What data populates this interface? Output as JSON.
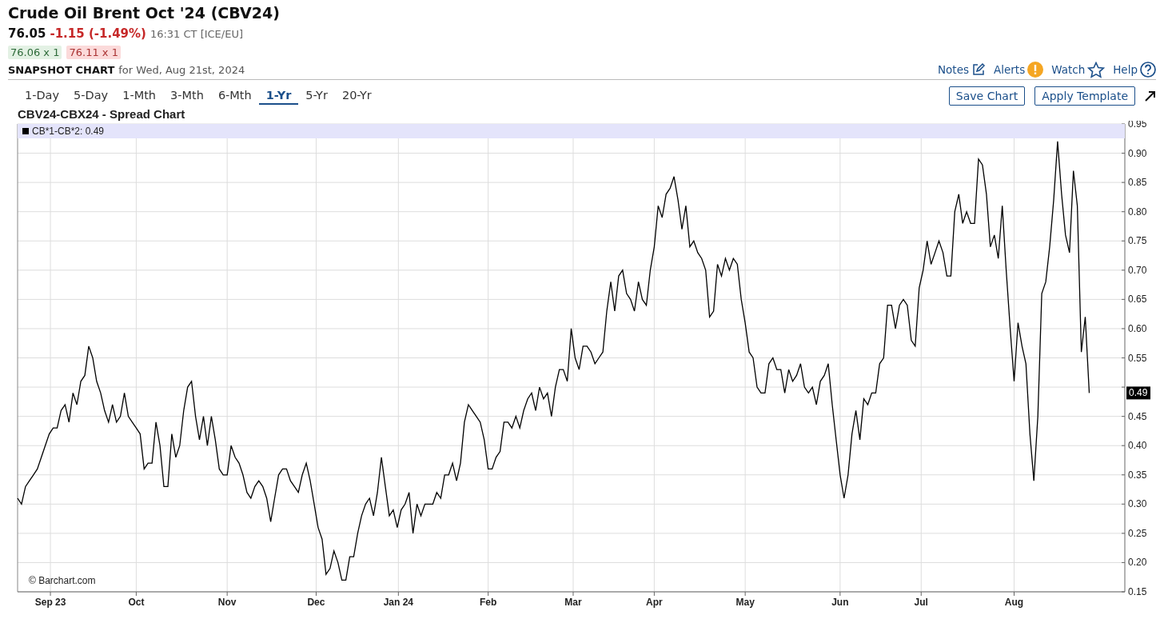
{
  "header": {
    "title": "Crude Oil Brent Oct '24 (CBV24)",
    "last": "76.05",
    "change": "-1.15 (-1.49%)",
    "time": "16:31 CT [ICE/EU]",
    "bid": "76.06 x 1",
    "ask": "76.11 x 1",
    "snapshot_label": "SNAPSHOT CHART",
    "snapshot_date": "for Wed, Aug 21st, 2024"
  },
  "links": [
    {
      "label": "Notes",
      "kind": "notes"
    },
    {
      "label": "Alerts",
      "kind": "alerts"
    },
    {
      "label": "Watch",
      "kind": "watch"
    },
    {
      "label": "Help",
      "kind": "help"
    }
  ],
  "ranges": [
    {
      "label": "1-Day",
      "selected": false
    },
    {
      "label": "5-Day",
      "selected": false
    },
    {
      "label": "1-Mth",
      "selected": false
    },
    {
      "label": "3-Mth",
      "selected": false
    },
    {
      "label": "6-Mth",
      "selected": false
    },
    {
      "label": "1-Yr",
      "selected": true
    },
    {
      "label": "5-Yr",
      "selected": false
    },
    {
      "label": "20-Yr",
      "selected": false
    }
  ],
  "buttons": [
    "Save Chart",
    "Apply Template"
  ],
  "chart": {
    "title": "CBV24-CBX24 - Spread Chart",
    "legend_suffix": ": 0.49",
    "last_label": "0.49",
    "credit": "© Barchart.com",
    "month_labels": [
      "Sep 23",
      "Oct",
      "Nov",
      "Dec",
      "Jan 24",
      "Feb",
      "Mar",
      "Apr",
      "May",
      "Jun",
      "Jul",
      "Aug"
    ],
    "chart_data": {
      "type": "line",
      "grid": true,
      "ylim": [
        0.15,
        0.95
      ],
      "yticks": [
        {
          "value": 0.15,
          "label": "0.15"
        },
        {
          "value": 0.2,
          "label": "0.20"
        },
        {
          "value": 0.25,
          "label": "0.25"
        },
        {
          "value": 0.3,
          "label": "0.30"
        },
        {
          "value": 0.35,
          "label": "0.35"
        },
        {
          "value": 0.4,
          "label": "0.40"
        },
        {
          "value": 0.45,
          "label": "0.45"
        },
        {
          "value": 0.55,
          "label": "0.55"
        },
        {
          "value": 0.6,
          "label": "0.60"
        },
        {
          "value": 0.65,
          "label": "0.65"
        },
        {
          "value": 0.7,
          "label": "0.70"
        },
        {
          "value": 0.75,
          "label": "0.75"
        },
        {
          "value": 0.8,
          "label": "0.80"
        },
        {
          "value": 0.85,
          "label": "0.85"
        },
        {
          "value": 0.9,
          "label": "0.90"
        },
        {
          "value": 0.95,
          "label": "0.95"
        }
      ],
      "series": [
        {
          "name": "CB*1-CB*2",
          "color": "#000000",
          "values": [
            0.31,
            0.3,
            0.33,
            0.34,
            0.35,
            0.36,
            0.38,
            0.4,
            0.42,
            0.43,
            0.43,
            0.46,
            0.47,
            0.44,
            0.49,
            0.47,
            0.51,
            0.52,
            0.57,
            0.55,
            0.51,
            0.49,
            0.46,
            0.44,
            0.47,
            0.44,
            0.45,
            0.49,
            0.45,
            0.44,
            0.43,
            0.42,
            0.36,
            0.37,
            0.37,
            0.44,
            0.4,
            0.33,
            0.33,
            0.42,
            0.38,
            0.4,
            0.46,
            0.5,
            0.51,
            0.45,
            0.41,
            0.45,
            0.4,
            0.45,
            0.41,
            0.36,
            0.35,
            0.35,
            0.4,
            0.38,
            0.37,
            0.35,
            0.32,
            0.31,
            0.33,
            0.34,
            0.33,
            0.31,
            0.27,
            0.31,
            0.35,
            0.36,
            0.36,
            0.34,
            0.33,
            0.32,
            0.35,
            0.37,
            0.34,
            0.3,
            0.26,
            0.24,
            0.18,
            0.19,
            0.22,
            0.2,
            0.17,
            0.17,
            0.21,
            0.21,
            0.25,
            0.28,
            0.3,
            0.31,
            0.28,
            0.32,
            0.38,
            0.33,
            0.28,
            0.29,
            0.26,
            0.29,
            0.3,
            0.32,
            0.25,
            0.3,
            0.28,
            0.3,
            0.3,
            0.3,
            0.32,
            0.31,
            0.35,
            0.35,
            0.37,
            0.34,
            0.37,
            0.44,
            0.47,
            0.46,
            0.45,
            0.44,
            0.41,
            0.36,
            0.36,
            0.38,
            0.39,
            0.44,
            0.44,
            0.43,
            0.45,
            0.43,
            0.46,
            0.48,
            0.49,
            0.46,
            0.5,
            0.48,
            0.49,
            0.45,
            0.5,
            0.53,
            0.53,
            0.51,
            0.6,
            0.55,
            0.53,
            0.57,
            0.57,
            0.56,
            0.54,
            0.55,
            0.56,
            0.63,
            0.68,
            0.63,
            0.69,
            0.7,
            0.66,
            0.65,
            0.63,
            0.68,
            0.65,
            0.64,
            0.7,
            0.74,
            0.81,
            0.79,
            0.83,
            0.84,
            0.86,
            0.82,
            0.77,
            0.81,
            0.74,
            0.75,
            0.73,
            0.72,
            0.7,
            0.62,
            0.63,
            0.71,
            0.69,
            0.72,
            0.7,
            0.72,
            0.71,
            0.65,
            0.61,
            0.56,
            0.55,
            0.5,
            0.49,
            0.49,
            0.54,
            0.55,
            0.53,
            0.53,
            0.49,
            0.53,
            0.51,
            0.52,
            0.54,
            0.5,
            0.49,
            0.5,
            0.47,
            0.51,
            0.52,
            0.54,
            0.47,
            0.41,
            0.35,
            0.31,
            0.35,
            0.42,
            0.46,
            0.41,
            0.48,
            0.47,
            0.49,
            0.49,
            0.54,
            0.55,
            0.64,
            0.64,
            0.6,
            0.64,
            0.65,
            0.64,
            0.58,
            0.57,
            0.67,
            0.7,
            0.75,
            0.71,
            0.73,
            0.75,
            0.73,
            0.69,
            0.69,
            0.8,
            0.83,
            0.78,
            0.8,
            0.78,
            0.78,
            0.89,
            0.88,
            0.83,
            0.74,
            0.76,
            0.72,
            0.81,
            0.7,
            0.6,
            0.51,
            0.61,
            0.57,
            0.54,
            0.42,
            0.34,
            0.45,
            0.66,
            0.68,
            0.74,
            0.82,
            0.92,
            0.83,
            0.76,
            0.73,
            0.87,
            0.81,
            0.56,
            0.62,
            0.49
          ]
        }
      ]
    }
  }
}
